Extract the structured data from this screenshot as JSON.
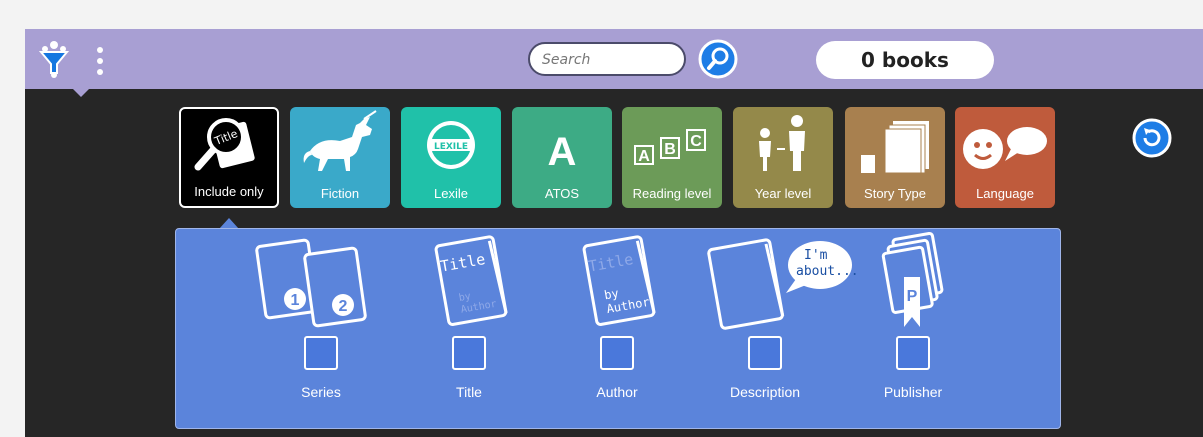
{
  "toolbar": {
    "search_placeholder": "Search",
    "book_count": "0 books",
    "accent_color": "#a89fd3"
  },
  "filters": [
    {
      "label": "Include only",
      "icon": "magnifier-title-icon",
      "color": "#000000",
      "selected": true,
      "icon_text": "Title"
    },
    {
      "label": "Fiction",
      "icon": "unicorn-icon",
      "color": "#3aa9c9"
    },
    {
      "label": "Lexile",
      "icon": "lexile-logo-icon",
      "color": "#20c1a9",
      "icon_text": "LEXILE"
    },
    {
      "label": "ATOS",
      "icon": "letter-a-icon",
      "color": "#3dab85",
      "icon_text": "A"
    },
    {
      "label": "Reading level",
      "icon": "abc-blocks-icon",
      "color": "#6c9b58",
      "icon_text": [
        "A",
        "B",
        "C"
      ]
    },
    {
      "label": "Year level",
      "icon": "people-height-icon",
      "color": "#94894a"
    },
    {
      "label": "Story Type",
      "icon": "book-stack-icon",
      "color": "#a8804f"
    },
    {
      "label": "Language",
      "icon": "speech-face-icon",
      "color": "#bf5b3c"
    }
  ],
  "include_options": [
    {
      "label": "Series",
      "icon": "series-books-icon",
      "checked": false,
      "icon_text": [
        "1",
        "2"
      ]
    },
    {
      "label": "Title",
      "icon": "title-book-icon",
      "checked": false,
      "icon_text": [
        "Title",
        "by",
        "Author"
      ]
    },
    {
      "label": "Author",
      "icon": "author-book-icon",
      "checked": false,
      "icon_text": [
        "Title",
        "by",
        "Author"
      ]
    },
    {
      "label": "Description",
      "icon": "description-book-icon",
      "checked": false,
      "icon_text": [
        "I'm",
        "about..."
      ]
    },
    {
      "label": "Publisher",
      "icon": "publisher-books-icon",
      "checked": false,
      "icon_text": "P"
    }
  ]
}
